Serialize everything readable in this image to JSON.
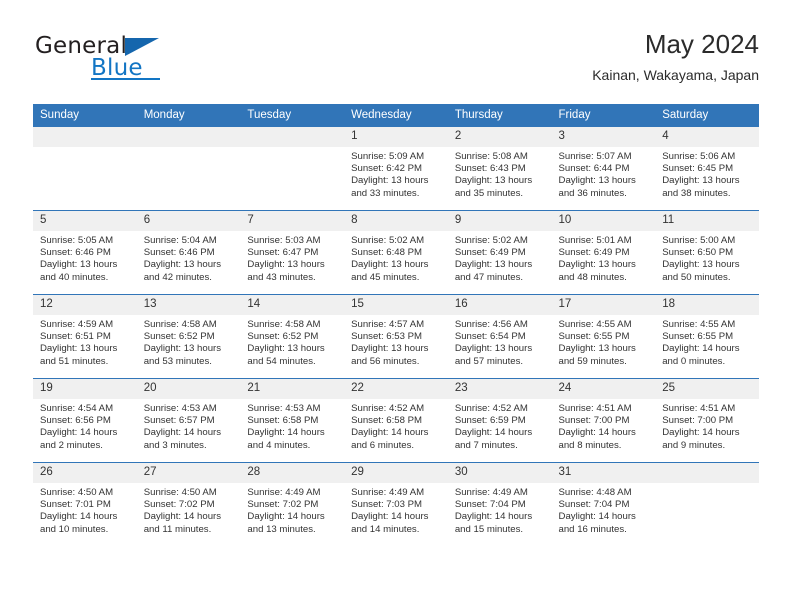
{
  "brand": {
    "name_part1": "General",
    "name_part2": "Blue",
    "flag_icon": "triangle-flag-icon"
  },
  "header": {
    "title": "May 2024",
    "subtitle": "Kainan, Wakayama, Japan"
  },
  "colors": {
    "header_blue": "#3175b8",
    "brand_blue": "#1275c4",
    "daynum_gray": "#f0f0f0"
  },
  "weekday_headers": [
    "Sunday",
    "Monday",
    "Tuesday",
    "Wednesday",
    "Thursday",
    "Friday",
    "Saturday"
  ],
  "weeks": [
    [
      {
        "day": "",
        "lines": []
      },
      {
        "day": "",
        "lines": []
      },
      {
        "day": "",
        "lines": []
      },
      {
        "day": "1",
        "lines": [
          "Sunrise: 5:09 AM",
          "Sunset: 6:42 PM",
          "Daylight: 13 hours",
          "and 33 minutes."
        ]
      },
      {
        "day": "2",
        "lines": [
          "Sunrise: 5:08 AM",
          "Sunset: 6:43 PM",
          "Daylight: 13 hours",
          "and 35 minutes."
        ]
      },
      {
        "day": "3",
        "lines": [
          "Sunrise: 5:07 AM",
          "Sunset: 6:44 PM",
          "Daylight: 13 hours",
          "and 36 minutes."
        ]
      },
      {
        "day": "4",
        "lines": [
          "Sunrise: 5:06 AM",
          "Sunset: 6:45 PM",
          "Daylight: 13 hours",
          "and 38 minutes."
        ]
      }
    ],
    [
      {
        "day": "5",
        "lines": [
          "Sunrise: 5:05 AM",
          "Sunset: 6:46 PM",
          "Daylight: 13 hours",
          "and 40 minutes."
        ]
      },
      {
        "day": "6",
        "lines": [
          "Sunrise: 5:04 AM",
          "Sunset: 6:46 PM",
          "Daylight: 13 hours",
          "and 42 minutes."
        ]
      },
      {
        "day": "7",
        "lines": [
          "Sunrise: 5:03 AM",
          "Sunset: 6:47 PM",
          "Daylight: 13 hours",
          "and 43 minutes."
        ]
      },
      {
        "day": "8",
        "lines": [
          "Sunrise: 5:02 AM",
          "Sunset: 6:48 PM",
          "Daylight: 13 hours",
          "and 45 minutes."
        ]
      },
      {
        "day": "9",
        "lines": [
          "Sunrise: 5:02 AM",
          "Sunset: 6:49 PM",
          "Daylight: 13 hours",
          "and 47 minutes."
        ]
      },
      {
        "day": "10",
        "lines": [
          "Sunrise: 5:01 AM",
          "Sunset: 6:49 PM",
          "Daylight: 13 hours",
          "and 48 minutes."
        ]
      },
      {
        "day": "11",
        "lines": [
          "Sunrise: 5:00 AM",
          "Sunset: 6:50 PM",
          "Daylight: 13 hours",
          "and 50 minutes."
        ]
      }
    ],
    [
      {
        "day": "12",
        "lines": [
          "Sunrise: 4:59 AM",
          "Sunset: 6:51 PM",
          "Daylight: 13 hours",
          "and 51 minutes."
        ]
      },
      {
        "day": "13",
        "lines": [
          "Sunrise: 4:58 AM",
          "Sunset: 6:52 PM",
          "Daylight: 13 hours",
          "and 53 minutes."
        ]
      },
      {
        "day": "14",
        "lines": [
          "Sunrise: 4:58 AM",
          "Sunset: 6:52 PM",
          "Daylight: 13 hours",
          "and 54 minutes."
        ]
      },
      {
        "day": "15",
        "lines": [
          "Sunrise: 4:57 AM",
          "Sunset: 6:53 PM",
          "Daylight: 13 hours",
          "and 56 minutes."
        ]
      },
      {
        "day": "16",
        "lines": [
          "Sunrise: 4:56 AM",
          "Sunset: 6:54 PM",
          "Daylight: 13 hours",
          "and 57 minutes."
        ]
      },
      {
        "day": "17",
        "lines": [
          "Sunrise: 4:55 AM",
          "Sunset: 6:55 PM",
          "Daylight: 13 hours",
          "and 59 minutes."
        ]
      },
      {
        "day": "18",
        "lines": [
          "Sunrise: 4:55 AM",
          "Sunset: 6:55 PM",
          "Daylight: 14 hours",
          "and 0 minutes."
        ]
      }
    ],
    [
      {
        "day": "19",
        "lines": [
          "Sunrise: 4:54 AM",
          "Sunset: 6:56 PM",
          "Daylight: 14 hours",
          "and 2 minutes."
        ]
      },
      {
        "day": "20",
        "lines": [
          "Sunrise: 4:53 AM",
          "Sunset: 6:57 PM",
          "Daylight: 14 hours",
          "and 3 minutes."
        ]
      },
      {
        "day": "21",
        "lines": [
          "Sunrise: 4:53 AM",
          "Sunset: 6:58 PM",
          "Daylight: 14 hours",
          "and 4 minutes."
        ]
      },
      {
        "day": "22",
        "lines": [
          "Sunrise: 4:52 AM",
          "Sunset: 6:58 PM",
          "Daylight: 14 hours",
          "and 6 minutes."
        ]
      },
      {
        "day": "23",
        "lines": [
          "Sunrise: 4:52 AM",
          "Sunset: 6:59 PM",
          "Daylight: 14 hours",
          "and 7 minutes."
        ]
      },
      {
        "day": "24",
        "lines": [
          "Sunrise: 4:51 AM",
          "Sunset: 7:00 PM",
          "Daylight: 14 hours",
          "and 8 minutes."
        ]
      },
      {
        "day": "25",
        "lines": [
          "Sunrise: 4:51 AM",
          "Sunset: 7:00 PM",
          "Daylight: 14 hours",
          "and 9 minutes."
        ]
      }
    ],
    [
      {
        "day": "26",
        "lines": [
          "Sunrise: 4:50 AM",
          "Sunset: 7:01 PM",
          "Daylight: 14 hours",
          "and 10 minutes."
        ]
      },
      {
        "day": "27",
        "lines": [
          "Sunrise: 4:50 AM",
          "Sunset: 7:02 PM",
          "Daylight: 14 hours",
          "and 11 minutes."
        ]
      },
      {
        "day": "28",
        "lines": [
          "Sunrise: 4:49 AM",
          "Sunset: 7:02 PM",
          "Daylight: 14 hours",
          "and 13 minutes."
        ]
      },
      {
        "day": "29",
        "lines": [
          "Sunrise: 4:49 AM",
          "Sunset: 7:03 PM",
          "Daylight: 14 hours",
          "and 14 minutes."
        ]
      },
      {
        "day": "30",
        "lines": [
          "Sunrise: 4:49 AM",
          "Sunset: 7:04 PM",
          "Daylight: 14 hours",
          "and 15 minutes."
        ]
      },
      {
        "day": "31",
        "lines": [
          "Sunrise: 4:48 AM",
          "Sunset: 7:04 PM",
          "Daylight: 14 hours",
          "and 16 minutes."
        ]
      },
      {
        "day": "",
        "lines": []
      }
    ]
  ]
}
